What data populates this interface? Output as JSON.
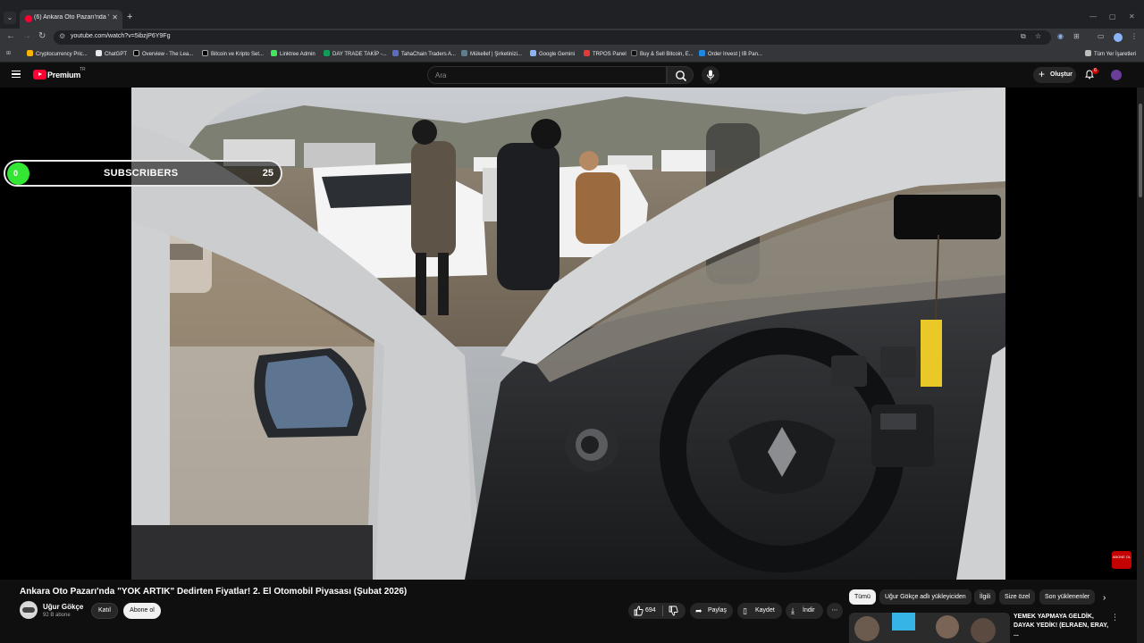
{
  "browser": {
    "tab_title": "(6) Ankara Oto Pazarı'nda \"YOK",
    "url": "youtube.com/watch?v=5ibzjP6Y9Fg",
    "all_bookmarks": "Tüm Yer İşaretleri",
    "bookmarks": [
      {
        "label": "Cryptocurrency Pric...",
        "color": "#f7b500"
      },
      {
        "label": "ChatGPT",
        "color": "#e8eaed"
      },
      {
        "label": "Overview - The Lea...",
        "color": "#202124"
      },
      {
        "label": "Bitcoin ve Kripto Set...",
        "color": "#202124"
      },
      {
        "label": "Linktree Admin",
        "color": "#43e55e"
      },
      {
        "label": "DAY TRADE TAKİP -...",
        "color": "#0f9d58"
      },
      {
        "label": "TahaChain Traders A...",
        "color": "#5c6bc0"
      },
      {
        "label": "Mükellef | Şirketinizi...",
        "color": "#607d8b"
      },
      {
        "label": "Google Gemini",
        "color": "#8ab4f8"
      },
      {
        "label": "TRPOS Panel",
        "color": "#e53935"
      },
      {
        "label": "Buy & Sell Bitcoin, E...",
        "color": "#111111"
      },
      {
        "label": "Order Invest | IB Pan...",
        "color": "#1e88e5"
      }
    ]
  },
  "youtube": {
    "brand": "Premium",
    "brand_suffix": "TR",
    "search_placeholder": "Ara",
    "create_label": "Oluştur",
    "notification_count": "6"
  },
  "overlay": {
    "dot_value": "0",
    "label": "SUBSCRIBERS",
    "count": "25",
    "corner_logo": "ABONE OL"
  },
  "video": {
    "title": "Ankara Oto Pazarı'nda \"YOK ARTIK\" Dedirten Fiyatlar! 2. El Otomobil Piyasası (Şubat 2026)",
    "channel": "Uğur Gökçe",
    "subscribers": "92 B abone",
    "join_label": "Katıl",
    "subscribe_label": "Abone ol",
    "likes": "694",
    "share_label": "Paylaş",
    "save_label": "Kaydet",
    "download_label": "İndir"
  },
  "chips": [
    "Tümü",
    "Uğur Gökçe adlı yükleyiciden",
    "İlgili",
    "Size özel",
    "Son yüklenenler"
  ],
  "recommendation": {
    "title": "YEMEK YAPMAYA GELDİK, DAYAK YEDİK! (ELRAEN, ERAY, ..."
  }
}
